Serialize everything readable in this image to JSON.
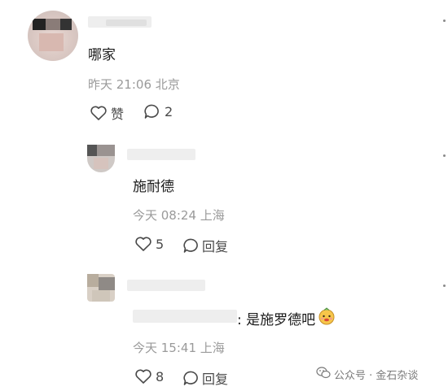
{
  "comment": {
    "username": "…nick",
    "text": "哪家",
    "meta": "昨天 21:06 北京",
    "like_label": "赞",
    "reply_count": "2",
    "icons": [
      "heart-icon",
      "comment-bubble-icon",
      "more-dots-icon"
    ]
  },
  "replies": [
    {
      "text": "施耐德",
      "meta": "今天 08:24 上海",
      "like_count": "5",
      "reply_label": "回复"
    },
    {
      "mention_suffix": ": 是施罗德吧",
      "emoji_icon": "smiling-face-emoji-icon",
      "meta": "今天 15:41 上海",
      "like_count": "8",
      "reply_label": "回复"
    }
  ],
  "watermark": {
    "text": "公众号 · 金石杂谈",
    "icon": "wechat-icon"
  },
  "colors": {
    "text": "#1a1a1a",
    "meta": "#9a9a9a",
    "icon": "#4a4a4a"
  }
}
